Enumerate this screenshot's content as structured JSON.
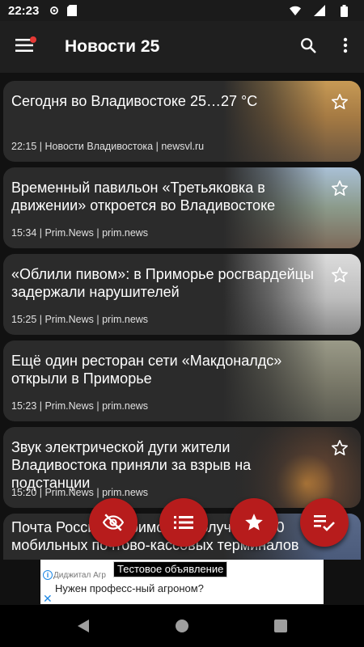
{
  "status_bar": {
    "time": "22:23"
  },
  "app_bar": {
    "title": "Новости 25"
  },
  "articles": [
    {
      "title": "Сегодня во Владивостоке 25…27 °C",
      "meta": "22:15 | Новости Владивостока | newsvl.ru",
      "thumb_color": "#b98a4a"
    },
    {
      "title": "Временный павильон «Третьяковка в движении» откроется во Владивостоке",
      "meta": "15:34 | Prim.News | prim.news",
      "thumb_color": "#7a8f9e"
    },
    {
      "title": "«Облили пивом»: в Приморье росгвардейцы задержали нарушителей",
      "meta": "15:25 | Prim.News | prim.news",
      "thumb_color": "#c9c9c9"
    },
    {
      "title": "Ещё один ресторан сети «Макдоналдс» открыли в Приморье",
      "meta": "15:23 | Prim.News | prim.news",
      "thumb_color": "#8a8a7a"
    },
    {
      "title": "Звук электрической дуги жители Владивостока приняли за взрыв на подстанции",
      "meta": "15:20 | Prim.News | prim.news",
      "thumb_color": "#3d3d3d"
    },
    {
      "title": "Почта России в Приморье получила 540 мобильных почтово-кассовых терминалов",
      "meta": "",
      "thumb_color": "#4a5a7a"
    }
  ],
  "ad": {
    "label": "Тестовое объявление",
    "advertiser": "Диджитал Агр",
    "text": "Нужен професс-ный агроном?"
  },
  "colors": {
    "accent": "#b71c1c",
    "card_bg": "#2b2b2b",
    "app_bar": "#1f1f1f"
  }
}
